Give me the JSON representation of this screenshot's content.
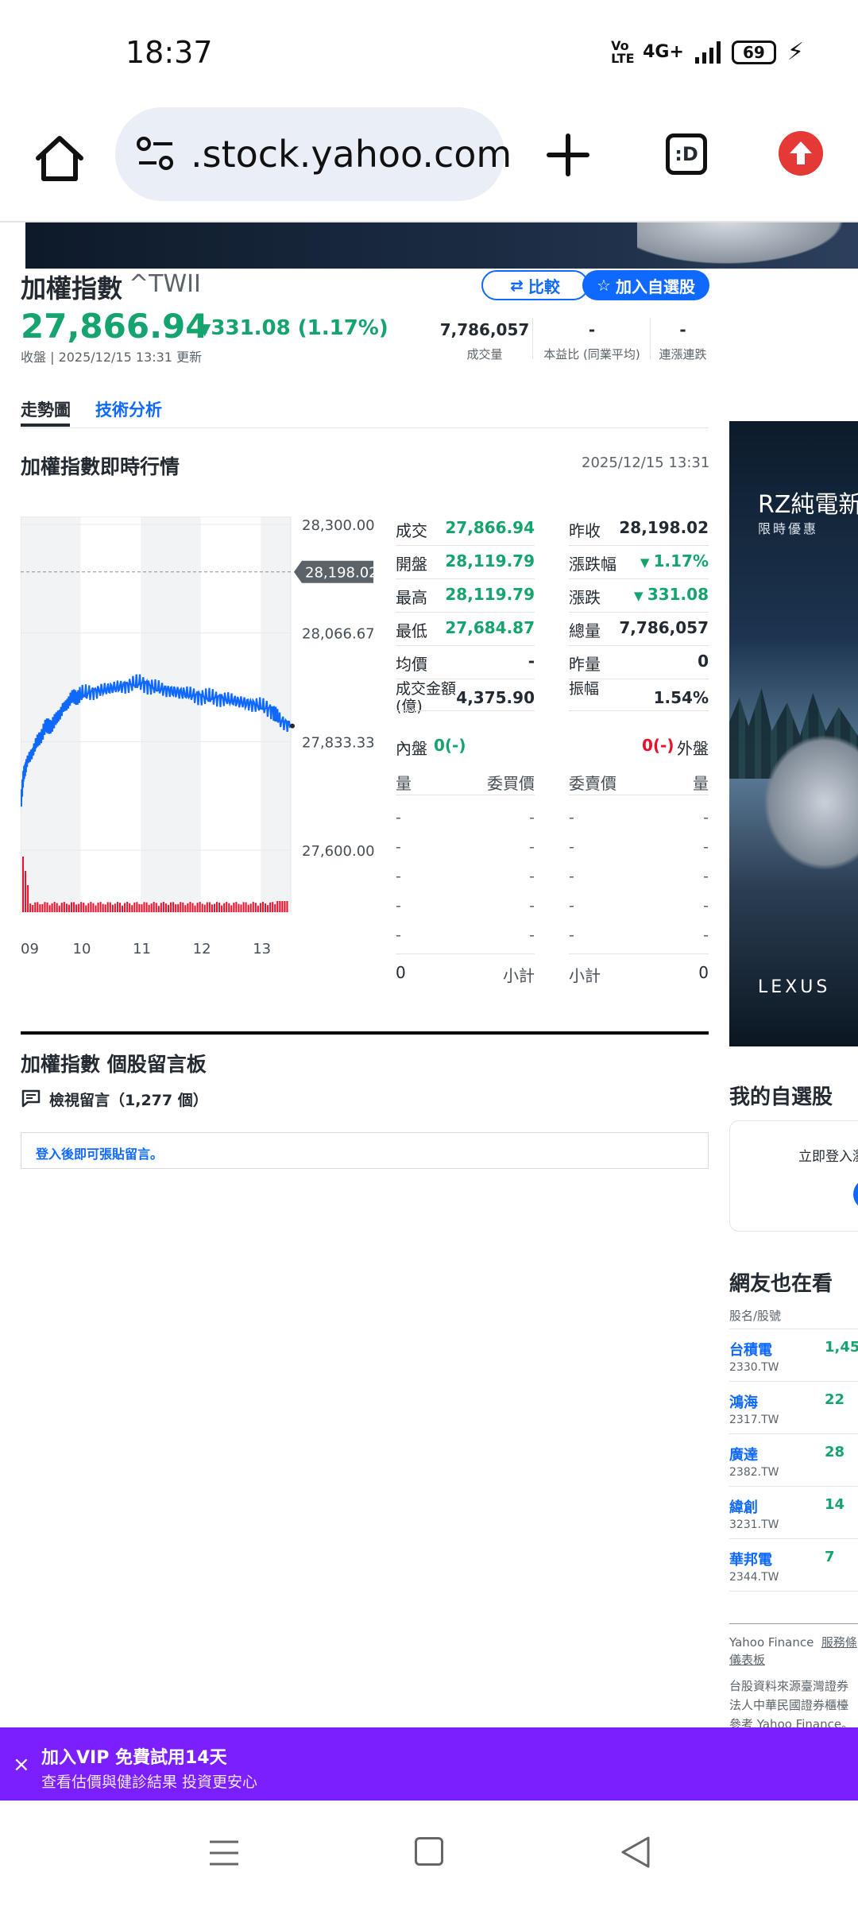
{
  "status_bar": {
    "time": "18:37",
    "volte": "Vo LTE",
    "network": "4G+",
    "battery": "69"
  },
  "browser": {
    "url": ".stock.yahoo.com",
    "tabs_label": ":D"
  },
  "header": {
    "name": "加權指數",
    "symbol": "^TWII",
    "compare_label": "比較",
    "watchlist_label": "加入自選股",
    "price": "27,866.94",
    "change": "331.08 (1.17%)",
    "update": "收盤 | 2025/12/15 13:31 更新",
    "stats": [
      {
        "value": "7,786,057",
        "label": "成交量"
      },
      {
        "value": "-",
        "label": "本益比 (同業平均)"
      },
      {
        "value": "-",
        "label": "連漲連跌"
      }
    ]
  },
  "tabs": [
    {
      "label": "走勢圖",
      "active": true
    },
    {
      "label": "技術分析",
      "active": false
    }
  ],
  "section": {
    "title": "加權指數即時行情",
    "time": "2025/12/15 13:31"
  },
  "chart_data": {
    "type": "line",
    "x_ticks": [
      "09",
      "10",
      "11",
      "12",
      "13"
    ],
    "y_ticks": [
      "28,300.00",
      "28,066.67",
      "27,833.33",
      "27,600.00"
    ],
    "ylim": [
      27600,
      28300
    ],
    "reference_label": "28,198.02",
    "reference_value": 28198.02,
    "series": [
      {
        "x": [
          9.0,
          9.05,
          9.1,
          9.2,
          9.3,
          9.4,
          9.5,
          9.6,
          9.7,
          9.8,
          9.9,
          10.0,
          10.2,
          10.4,
          10.6,
          10.8,
          11.0,
          11.2,
          11.4,
          11.6,
          11.8,
          12.0,
          12.2,
          12.4,
          12.6,
          12.8,
          13.0,
          13.2,
          13.3,
          13.5
        ],
        "values": [
          27700,
          27760,
          27790,
          27810,
          27840,
          27860,
          27870,
          27880,
          27905,
          27920,
          27930,
          27935,
          27940,
          27945,
          27950,
          27955,
          27960,
          27950,
          27945,
          27940,
          27935,
          27930,
          27928,
          27925,
          27920,
          27915,
          27910,
          27900,
          27880,
          27866.94
        ]
      }
    ],
    "volume_note": "volume bars shown in red below line"
  },
  "quote": {
    "left": [
      {
        "label": "成交",
        "value": "27,866.94",
        "color": "#15a36e"
      },
      {
        "label": "開盤",
        "value": "28,119.79",
        "color": "#15a36e"
      },
      {
        "label": "最高",
        "value": "28,119.79",
        "color": "#15a36e"
      },
      {
        "label": "最低",
        "value": "27,684.87",
        "color": "#15a36e"
      },
      {
        "label": "均價",
        "value": "-",
        "color": "#232a31"
      },
      {
        "label": "成交金額\n(億)",
        "value": "4,375.90",
        "color": "#232a31"
      }
    ],
    "right": [
      {
        "label": "昨收",
        "value": "28,198.02",
        "color": "#232a31"
      },
      {
        "label": "漲跌幅",
        "value": "1.17%",
        "color": "#15a36e",
        "arrow": true
      },
      {
        "label": "漲跌",
        "value": "331.08",
        "color": "#15a36e",
        "arrow": true
      },
      {
        "label": "總量",
        "value": "7,786,057",
        "color": "#232a31"
      },
      {
        "label": "昨量",
        "value": "0",
        "color": "#232a31"
      },
      {
        "label": "振幅",
        "value": "1.54%",
        "color": "#232a31"
      }
    ]
  },
  "orderbook": {
    "inner_label": "內盤",
    "inner_value": "0(-)",
    "outer_label": "外盤",
    "outer_value": "0(-)",
    "headers": [
      "量",
      "委買價",
      "委賣價",
      "量"
    ],
    "rows": [
      [
        "-",
        "-",
        "-",
        "-"
      ],
      [
        "-",
        "-",
        "-",
        "-"
      ],
      [
        "-",
        "-",
        "-",
        "-"
      ],
      [
        "-",
        "-",
        "-",
        "-"
      ],
      [
        "-",
        "-",
        "-",
        "-"
      ]
    ],
    "subtotal_left_value": "0",
    "subtotal_label": "小計",
    "subtotal_right_value": "0"
  },
  "board": {
    "title": "加權指數 個股留言板",
    "view_label": "檢視留言（1,277 個）",
    "login_prompt": "登入後即可張貼留言。"
  },
  "right_ad": {
    "title": "RZ純電新",
    "subtitle": "限時優惠",
    "logo": "LEXUS"
  },
  "my_watchlist": {
    "title": "我的自選股",
    "prompt": "立即登入瀏"
  },
  "also_viewed": {
    "title": "網友也在看",
    "header": "股名/股號",
    "items": [
      {
        "name": "台積電",
        "code": "2330.TW",
        "price": "1,45"
      },
      {
        "name": "鴻海",
        "code": "2317.TW",
        "price": "22"
      },
      {
        "name": "廣達",
        "code": "2382.TW",
        "price": "28"
      },
      {
        "name": "緯創",
        "code": "3231.TW",
        "price": "14"
      },
      {
        "name": "華邦電",
        "code": "2344.TW",
        "price": "7"
      }
    ]
  },
  "footer": {
    "line1_a": "Yahoo Finance",
    "line1_b": "服務條",
    "line2": "儀表板",
    "note1": "台股資料來源臺灣證券",
    "note2": "法人中華民國證券櫃檯",
    "note3": "參考 Yahoo Finance。"
  },
  "vip": {
    "close": "×",
    "title": "加入VIP 免費試用14天",
    "subtitle": "查看估價與健診結果 投資更安心"
  }
}
